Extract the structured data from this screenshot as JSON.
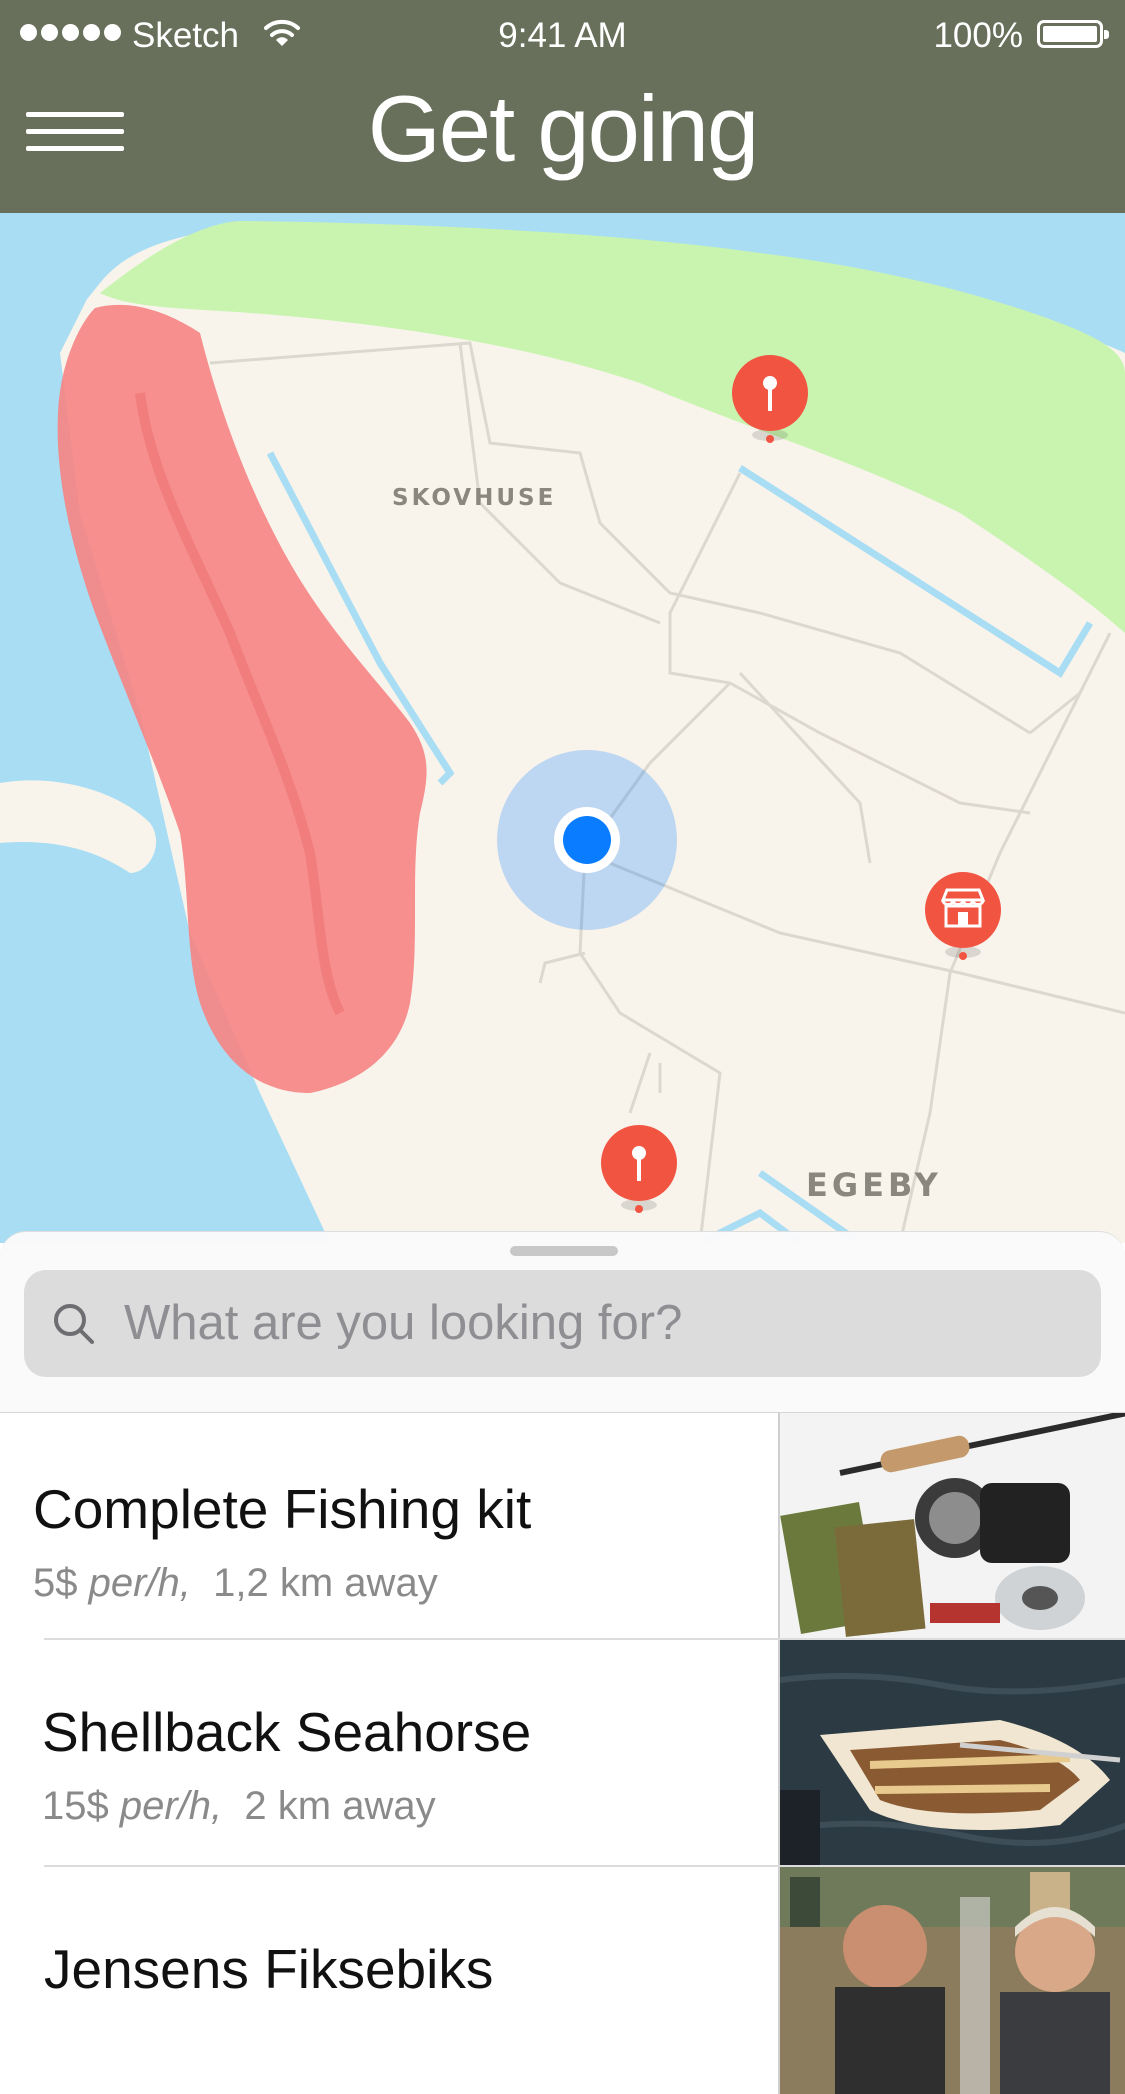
{
  "status_bar": {
    "carrier": "Sketch",
    "time": "9:41 AM",
    "battery": "100%"
  },
  "nav": {
    "title": "Get going",
    "menu_icon": "hamburger-menu-icon"
  },
  "map": {
    "labels": {
      "skovhuse": "SKOVHUSE",
      "egeby": "EGEBY"
    },
    "pins": [
      {
        "name": "location-pin",
        "icon": "pin-icon",
        "color": "#f25442"
      },
      {
        "name": "shop-pin",
        "icon": "storefront-icon",
        "color": "#f25442"
      },
      {
        "name": "location-pin",
        "icon": "pin-icon",
        "color": "#f25442"
      }
    ],
    "user_location_color": "#0a7cff",
    "colors": {
      "water": "#a9ddf3",
      "land": "#f8f4ec",
      "park": "#c9f4b0",
      "restricted": "#f58585"
    }
  },
  "search": {
    "placeholder": "What are you looking for?",
    "value": ""
  },
  "listings": [
    {
      "title": "Complete Fishing kit",
      "price": "5$",
      "unit": "per/h,",
      "distance": "1,2 km away",
      "image": "fishing-kit-photo"
    },
    {
      "title": "Shellback Seahorse",
      "price": "15$",
      "unit": "per/h,",
      "distance": "2 km away",
      "image": "rowboat-photo"
    },
    {
      "title": "Jensens Fiksebiks",
      "image": "shopkeepers-photo"
    }
  ]
}
